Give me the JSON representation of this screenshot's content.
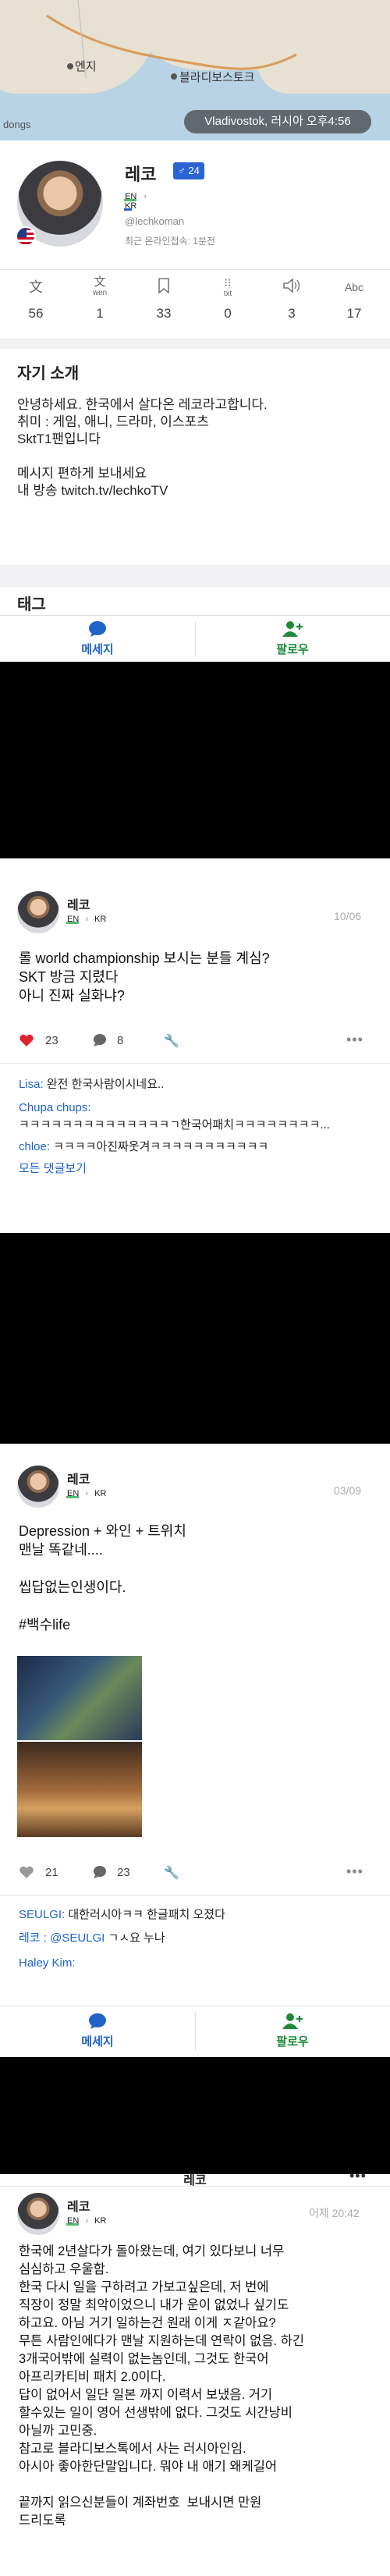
{
  "map": {
    "label_city1": "엔지",
    "label_city2": "블라디보스토크",
    "label_region": "dongs",
    "location_pill": "Vladivostok, 러시아 오후4:56"
  },
  "profile": {
    "name": "레코",
    "gender_age": "♂ 24",
    "lang_from": "EN",
    "lang_to": "KR",
    "handle": "@lechkoman",
    "last_seen": "최근 온라인접속: 1분전"
  },
  "stats": [
    {
      "icon": "文",
      "sub": "",
      "value": "56"
    },
    {
      "icon": "文",
      "sub": "wen",
      "value": "1"
    },
    {
      "icon": "🔖",
      "sub": "",
      "value": "33"
    },
    {
      "icon": "⦿",
      "sub": "txt",
      "value": "0"
    },
    {
      "icon": "🔊",
      "sub": "",
      "value": "3"
    },
    {
      "icon": "Abc",
      "sub": "",
      "value": "17"
    }
  ],
  "intro": {
    "title": "자기 소개",
    "lines": [
      "안녕하세요. 한국에서 살다온 레코라고합니다.",
      "취미 : 게임, 애니, 드라마, 이스포츠",
      "SktT1팬입니다",
      "",
      "메시지 편하게 보내세요",
      "내 방송 twitch.tv/lechkoTV"
    ]
  },
  "tags_title": "태그",
  "bottom_bar": {
    "message": "메세지",
    "follow": "팔로우"
  },
  "posts": [
    {
      "name": "레코",
      "lang_from": "EN",
      "lang_to": "KR",
      "date": "10/06",
      "body": "롤 world championship 보시는 분들 계심?\nSKT 방금 지렸다\n아니 진짜 실화냐?",
      "likes": "23",
      "comments": "8",
      "comment_lines": [
        {
          "user": "Lisa:",
          "text": " 완전 한국사람이시네요.."
        },
        {
          "user": "Chupa chups:",
          "text": ""
        },
        {
          "user": "",
          "text": "ㅋㅋㅋㅋㅋㅋㅋㅋㅋㅋㅋㅋㅋㅋㄱ한국어패치ㅋㅋㅋㅋㅋㅋㅋㅋ..."
        },
        {
          "user": "chloe:",
          "text": " ㅋㅋㅋㅋ아진짜웃겨ㅋㅋㅋㅋㅋㅋㅋㅋㅋㅋㅋ"
        }
      ],
      "see_all": "모든 댓글보기"
    },
    {
      "name": "레코",
      "lang_from": "EN",
      "lang_to": "KR",
      "date": "03/09",
      "body": "Depression + 와인 + 트위치\n맨날 똑같네....\n\n씹답없는인생이다.\n\n#백수life",
      "likes": "21",
      "comments": "23",
      "comment_lines": [
        {
          "user": "SEULGI:",
          "text": " 대한러시아ㅋㅋ 한글패치 오졌다"
        },
        {
          "user": "레코 : @SEULGI",
          "text": " ㄱㅅ요 누나"
        },
        {
          "user": "Haley Kim:",
          "text": ""
        }
      ]
    },
    {
      "header_name": "레코",
      "name": "레코",
      "lang_from": "EN",
      "lang_to": "KR",
      "date": "어제 20:42",
      "body": "한국에 2년살다가 돌아왔는데, 여기 있다보니 너무\n심심하고 우울함.\n한국 다시 일을 구하려고 가보고싶은데, 저 번에\n직장이 정말 최악이었으니 내가 운이 없었나 싶기도\n하고요. 아님 거기 일하는건 원래 이게 ㅈ같아요?\n무튼 사람인에다가 맨날 지원하는데 연락이 없음. 하긴\n3개국어밖에 실력이 없는놈인데, 그것도 한국어\n아프리카티비 패치 2.0이다.\n답이 없어서 일단 일본 까지 이력서 보냈음. 거기\n할수있는 일이 영어 선생밖에 없다. 그것도 시간낭비\n아닐까 고민중.\n참고로 블라디보스톡에서 사는 러시아인임.\n아시아 좋아한단말입니다. 뭐야 내 애기 왜케길어\n\n끝까지 읽으신분들이 계좌번호  보내시면 만원\n드리도록"
    }
  ],
  "colors": {
    "accent_blue": "#1e63c8",
    "accent_green": "#1e8a3a",
    "heart_red": "#e0242e",
    "lang_green": "#55b870"
  }
}
